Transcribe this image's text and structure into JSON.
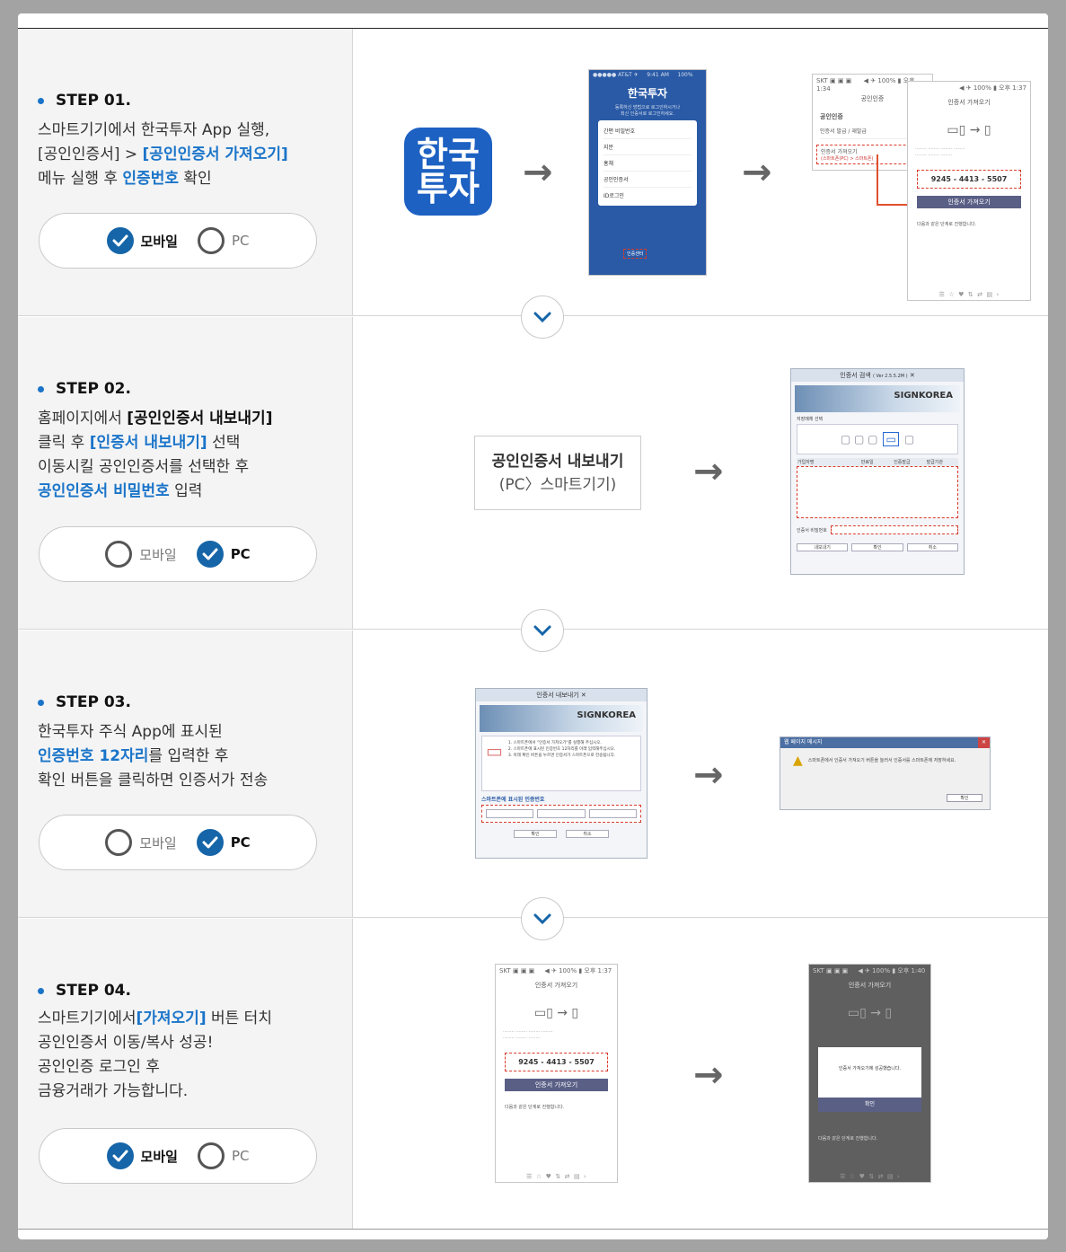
{
  "steps": [
    {
      "title": "STEP 01.",
      "lines": [
        [
          {
            "t": "스마트기기에서 한국투자 App 실행,"
          }
        ],
        [
          {
            "t": "[공인인증서] > "
          },
          {
            "t": "[공인인증서 가져오기]",
            "s": "blue"
          }
        ],
        [
          {
            "t": "메뉴 실행 후 "
          },
          {
            "t": "인증번호",
            "s": "blue"
          },
          {
            "t": " 확인"
          }
        ]
      ],
      "mobile_label": "모바일",
      "pc_label": "PC",
      "selected": "mobile"
    },
    {
      "title": "STEP 02.",
      "lines": [
        [
          {
            "t": "홈페이지에서 "
          },
          {
            "t": "[공인인증서 내보내기]",
            "s": "bold"
          }
        ],
        [
          {
            "t": "클릭 후 "
          },
          {
            "t": "[인증서 내보내기]",
            "s": "blue"
          },
          {
            "t": " 선택"
          }
        ],
        [
          {
            "t": "이동시킬 공인인증서를 선택한 후"
          }
        ],
        [
          {
            "t": "공인인증서 비밀번호",
            "s": "blue"
          },
          {
            "t": " 입력"
          }
        ]
      ],
      "mobile_label": "모바일",
      "pc_label": "PC",
      "selected": "pc"
    },
    {
      "title": "STEP 03.",
      "lines": [
        [
          {
            "t": "한국투자 주식 App에 표시된"
          }
        ],
        [
          {
            "t": "인증번호 12자리",
            "s": "blue"
          },
          {
            "t": "를 입력한 후"
          }
        ],
        [
          {
            "t": "확인 버튼을 클릭하면 인증서가 전송"
          }
        ]
      ],
      "mobile_label": "모바일",
      "pc_label": "PC",
      "selected": "pc"
    },
    {
      "title": "STEP 04.",
      "lines": [
        [
          {
            "t": "스마트기기에서"
          },
          {
            "t": "[가져오기]",
            "s": "blue"
          },
          {
            "t": " 버튼 터치"
          }
        ],
        [
          {
            "t": "공인인증서 이동/복사 성공!"
          }
        ],
        [
          {
            "t": "공인인증 로그인 후"
          }
        ],
        [
          {
            "t": "금융거래가 가능합니다."
          }
        ]
      ],
      "mobile_label": "모바일",
      "pc_label": "PC",
      "selected": "mobile"
    }
  ],
  "step1_visuals": {
    "app_icon_line1": "한국",
    "app_icon_line2": "투자",
    "phone1_title": "한국투자",
    "phone1_menu": [
      "간편 비밀번호",
      "지문",
      "홍채",
      "공인인증서",
      "ID로그인"
    ],
    "phone1_footer": "인증센터",
    "phone2_title": "공인인증",
    "phone2_item1": "인증서 발급 / 재발급",
    "phone2_item2": "인증서 가져오기",
    "phone2_item2_sub": "(스마트폰(PC) > 스마트폰)",
    "phone3_title": "인증서 가져오기",
    "auth_number": "9245 - 4413 - 5507",
    "import_button": "인증서 가져오기",
    "next_step_text": "다음과 같은 단계로 진행합니다."
  },
  "step2_visuals": {
    "export_line1": "공인인증서 내보내기",
    "export_line2": "(PC〉스마트기기)",
    "window_title": "인증서 검색",
    "window_version": "( Ver 2.5.5.2M )",
    "brand": "SIGNKOREA",
    "store_label": "저장매체 선택",
    "columns": [
      "가입자명",
      "만료일",
      "인증발급",
      "발급기관"
    ],
    "password_label": "인증서 비밀번호",
    "buttons": [
      "내보내기",
      "확인",
      "취소"
    ]
  },
  "step3_visuals": {
    "window_title": "인증서 내보내기",
    "brand": "SIGNKOREA",
    "instructions": [
      "1. 스마트폰에서 \"인증서 가져오기\"를 실행해 주십시오.",
      "2. 스마트폰에 표시된 인증번호 12자리를 아래 입력해주십시오.",
      "3. 아래 확인 버튼을 누르면 인증서가 스마트폰으로 전송됩니다."
    ],
    "input_label": "스마트폰에 표시된 인증번호",
    "buttons": [
      "확인",
      "취소"
    ],
    "dialog_title": "웹 페이지 메시지",
    "dialog_text": "스마트폰에서 인증서 가져오기 버튼을 눌러서 인증서를 스마트폰에 저장하세요.",
    "dialog_button": "확인"
  },
  "step4_visuals": {
    "phone_title": "인증서 가져오기",
    "auth_number": "9245 - 4413 - 5507",
    "import_button": "인증서 가져오기",
    "next_step_text": "다음과 같은 단계로 진행합니다.",
    "popup_text": "인증서 가져오기에 성공했습니다.",
    "popup_button": "확인"
  },
  "colors": {
    "accent": "#1a74c9",
    "check": "#1565a8",
    "divider": "#d6d6d6"
  },
  "icons": {
    "arrow": "→",
    "chevron": "chevron-down-icon",
    "check": "check-icon"
  }
}
